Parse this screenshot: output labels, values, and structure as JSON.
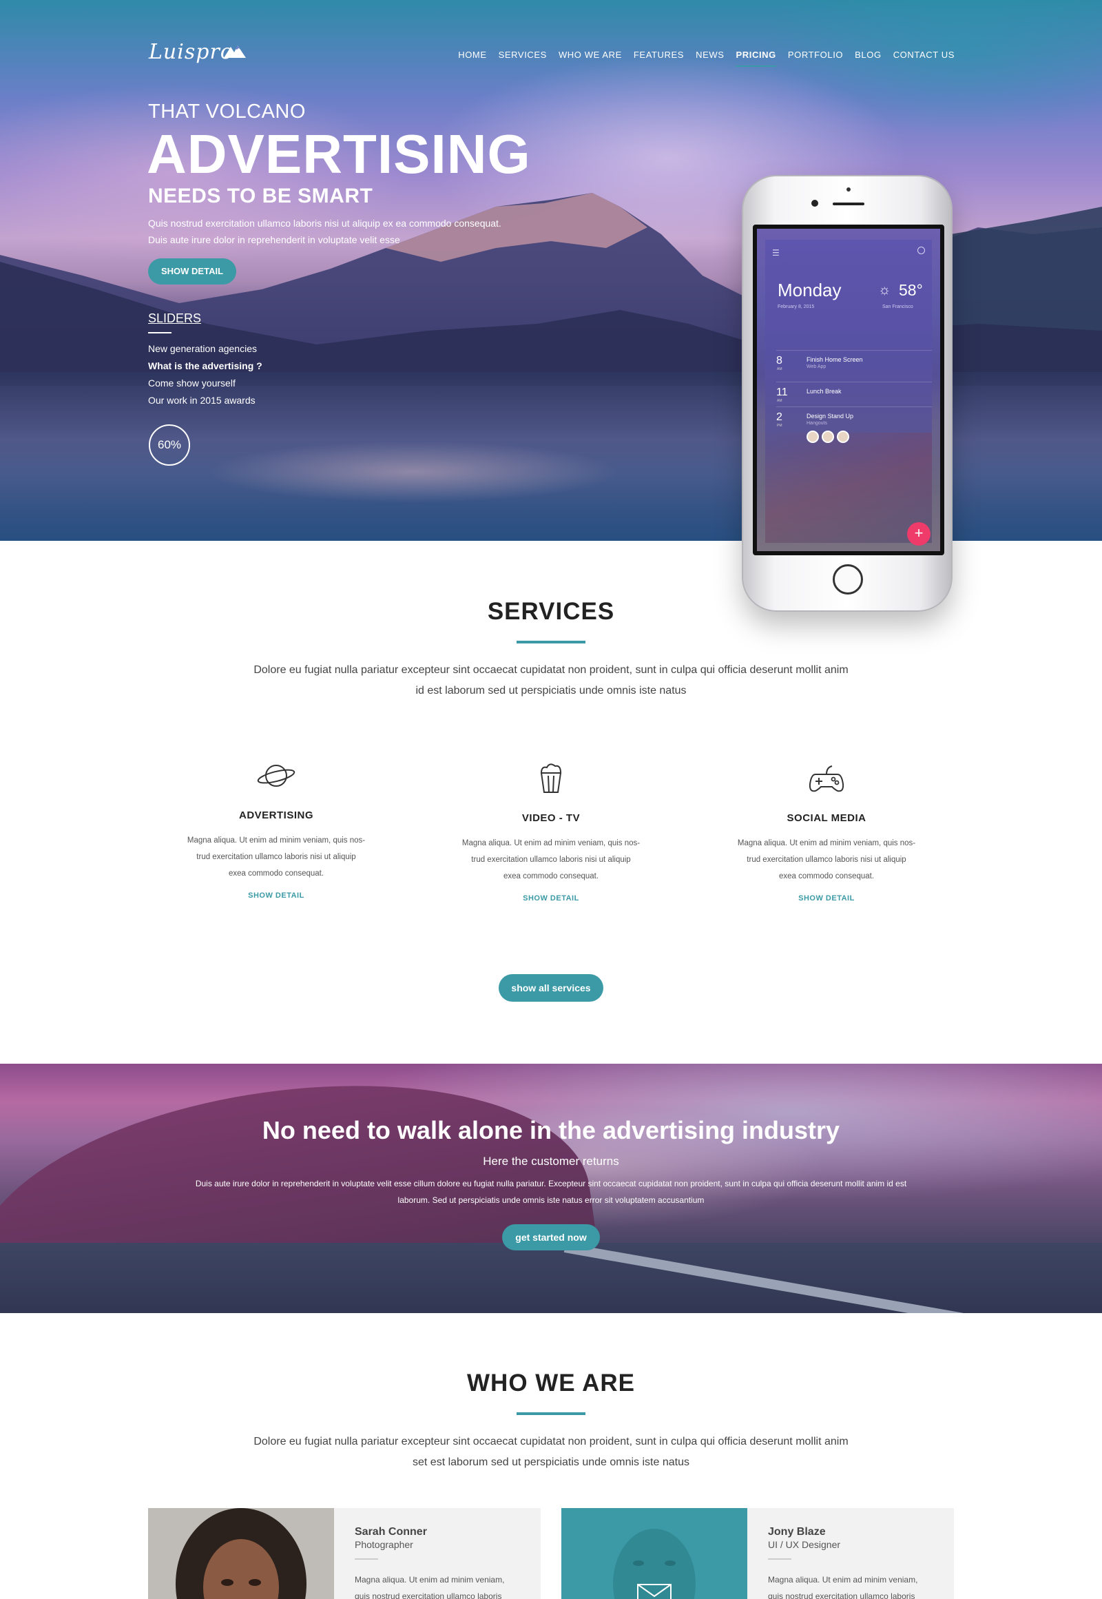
{
  "brand": {
    "logo": "Luispro",
    "accent": "#3b9aa6"
  },
  "nav": [
    "HOME",
    "SERVICES",
    "WHO WE ARE",
    "FEATURES",
    "NEWS",
    "PRICING",
    "PORTFOLIO",
    "BLOG",
    "CONTACT US"
  ],
  "nav_active": "PRICING",
  "hero": {
    "pre": "THAT VOLCANO",
    "title": "ADVERTISING",
    "subtitle": "NEEDS TO BE SMART",
    "text_line1": "Quis nostrud exercitation ullamco laboris nisi ut aliquip ex ea commodo consequat.",
    "text_line2": "Duis aute irure dolor in reprehenderit in voluptate velit esse",
    "button": "SHOW DETAIL",
    "sliders_label": "SLIDERS",
    "slider_items": [
      "New generation agencies",
      "What is the advertising ?",
      "Come show yourself",
      "Our work in 2015 awards"
    ],
    "progress": "60%"
  },
  "phone": {
    "day": "Monday",
    "date": "February 8, 2015",
    "temp": "58°",
    "city": "San Francisco",
    "events": [
      {
        "hour": "8",
        "ampm": "AM",
        "title": "Finish Home Screen",
        "sub": "Web App"
      },
      {
        "hour": "11",
        "ampm": "AM",
        "title": "Lunch Break",
        "sub": ""
      },
      {
        "hour": "2",
        "ampm": "PM",
        "title": "Design Stand Up",
        "sub": "Hangouts"
      }
    ],
    "fab": "+"
  },
  "services": {
    "title": "SERVICES",
    "text_line1": "Dolore eu fugiat nulla pariatur excepteur sint occaecat cupidatat non proident, sunt in culpa qui officia deserunt mollit anim",
    "text_line2": "id est laborum sed ut perspiciatis unde omnis iste natus",
    "items": [
      {
        "icon": "planet-icon",
        "title": "ADVERTISING",
        "line1": "Magna aliqua. Ut enim ad minim veniam, quis nos-",
        "line2": "trud exercitation ullamco laboris nisi ut aliquip",
        "line3": "exea commodo consequat.",
        "link": "SHOW DETAIL"
      },
      {
        "icon": "popcorn-icon",
        "title": "VIDEO - TV",
        "line1": "Magna aliqua. Ut enim ad minim veniam, quis nos-",
        "line2": "trud exercitation ullamco laboris nisi ut aliquip",
        "line3": "exea commodo consequat.",
        "link": "SHOW DETAIL"
      },
      {
        "icon": "gamepad-icon",
        "title": "SOCIAL MEDIA",
        "line1": "Magna aliqua. Ut enim ad minim veniam, quis nos-",
        "line2": "trud exercitation ullamco laboris nisi ut aliquip",
        "line3": "exea commodo consequat.",
        "link": "SHOW DETAIL"
      }
    ],
    "all_button": "show all services"
  },
  "banner": {
    "title": "No need to walk alone in the advertising industry",
    "subtitle": "Here the customer returns",
    "text_line1": "Duis aute irure dolor in reprehenderit in voluptate velit esse cillum dolore eu fugiat nulla pariatur. Excepteur sint occaecat cupidatat non proident, sunt in culpa qui officia deserunt mollit anim id est",
    "text_line2": "laborum. Sed ut perspiciatis unde omnis iste natus error sit voluptatem accusantium",
    "button": "get started now"
  },
  "who": {
    "title": "WHO WE ARE",
    "text_line1": "Dolore eu fugiat nulla pariatur excepteur sint occaecat cupidatat non proident, sunt in culpa qui officia deserunt mollit anim",
    "text_line2": "set est laborum sed ut perspiciatis unde omnis iste natus",
    "members": [
      {
        "name": "Sarah Conner",
        "role": "Photographer",
        "line1": "Magna aliqua. Ut enim ad minim veniam,",
        "line2": "quis nostrud exercitation ullamco laboris"
      },
      {
        "name": "Jony Blaze",
        "role": "UI / UX Designer",
        "line1": "Magna aliqua. Ut enim ad minim veniam,",
        "line2": "quis nostrud exercitation ullamco laboris"
      }
    ]
  }
}
